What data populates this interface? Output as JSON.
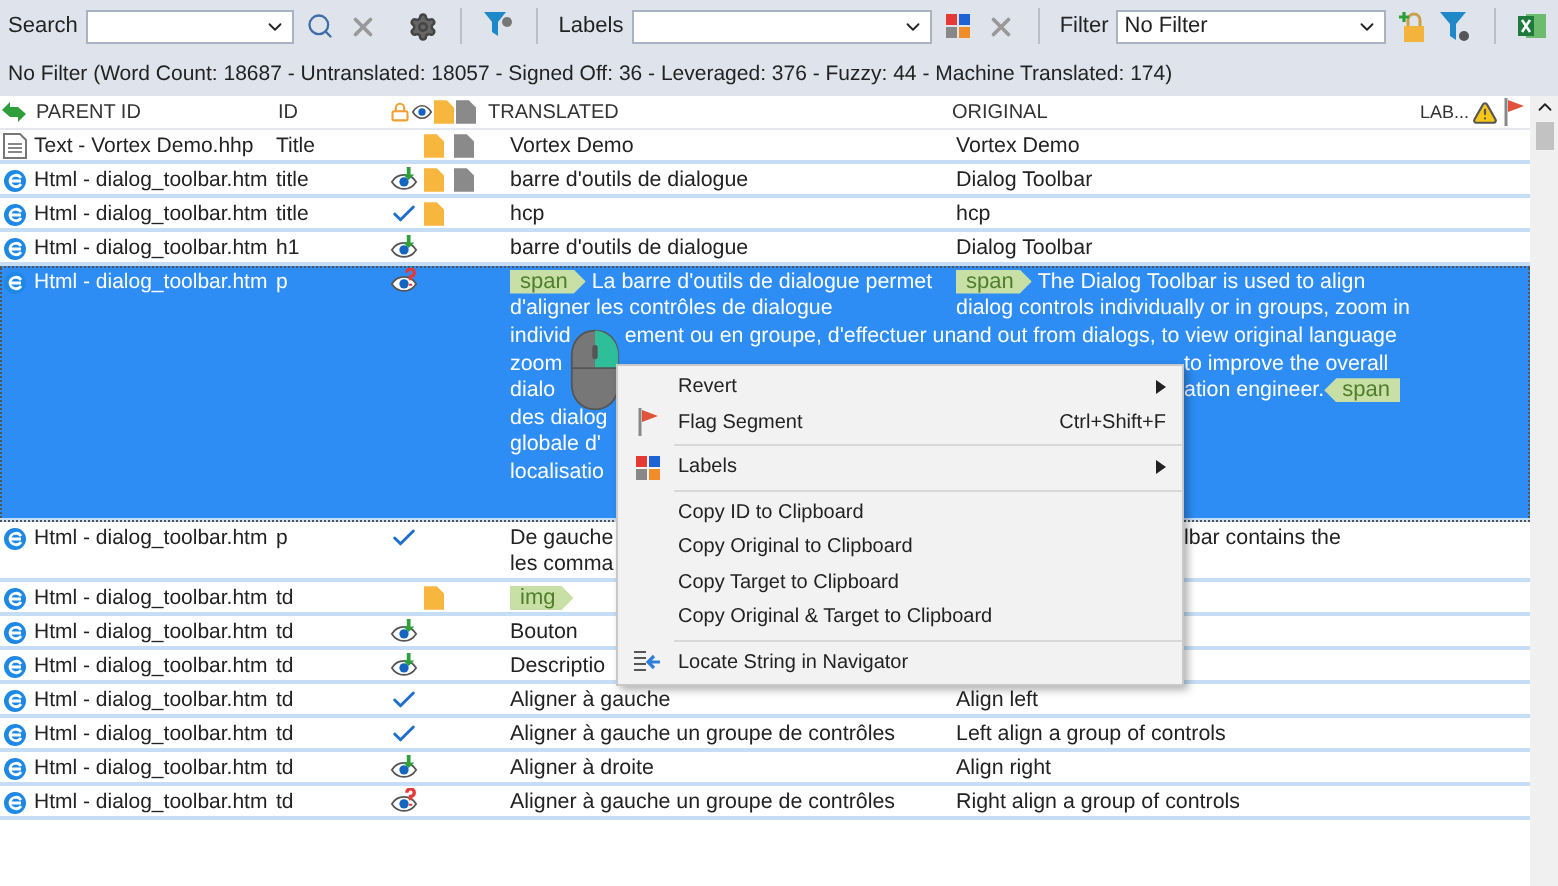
{
  "toolbar": {
    "search_label": "Search",
    "labels_label": "Labels",
    "filter_label": "Filter",
    "filter_value": "No Filter"
  },
  "status_text": "No Filter (Word Count: 18687 - Untranslated: 18057 - Signed Off: 36 - Leveraged: 376 - Fuzzy: 44 - Machine Translated: 174)",
  "columns": {
    "parent_id": "PARENT ID",
    "id": "ID",
    "translated": "TRANSLATED",
    "original": "ORIGINAL",
    "labels": "LAB..."
  },
  "rows": [
    {
      "kind": "text",
      "parent_id": "Text - Vortex Demo.hhp",
      "id": "Title",
      "memo": true,
      "comment": true,
      "selected": false,
      "translated": "Vortex Demo",
      "original": "Vortex Demo"
    },
    {
      "kind": "html",
      "parent_id": "Html - dialog_toolbar.htm",
      "id": "title",
      "status": {
        "kind": "leveraged"
      },
      "memo": true,
      "comment": true,
      "selected": false,
      "translated": "barre d'outils de dialogue",
      "original": "Dialog Toolbar"
    },
    {
      "kind": "html",
      "parent_id": "Html - dialog_toolbar.htm",
      "id": "title",
      "status": {
        "kind": "signed_off"
      },
      "memo": true,
      "comment": false,
      "selected": false,
      "translated": "hcp",
      "original": "hcp"
    },
    {
      "kind": "html",
      "parent_id": "Html - dialog_toolbar.htm",
      "id": "h1",
      "status": {
        "kind": "leveraged"
      },
      "memo": false,
      "comment": false,
      "selected": false,
      "translated": "barre d'outils de dialogue",
      "original": "Dialog Toolbar"
    },
    {
      "kind": "html",
      "parent_id": "Html - dialog_toolbar.htm",
      "id": "p",
      "status": {
        "kind": "unsure"
      },
      "memo": false,
      "comment": false,
      "selected": true,
      "translated": [
        {
          "kind": "full",
          "parts": [
            {
              "kind": "open_tag",
              "text": "span"
            },
            {
              "kind": "text",
              "text": "La barre d'outils de dialogue permet"
            }
          ]
        },
        {
          "kind": "full",
          "parts": [
            {
              "kind": "text",
              "text": "d'aligner les contrôles de dialogue"
            }
          ]
        },
        {
          "kind": "full",
          "parts": [
            {
              "kind": "text",
              "text": "individ"
            },
            {
              "kind": "gap_text",
              "text": "ement ou en groupe, d'effectuer un"
            }
          ]
        },
        {
          "kind": "full",
          "parts": [
            {
              "kind": "text",
              "text": "zoom"
            }
          ]
        },
        {
          "kind": "full",
          "parts": [
            {
              "kind": "text",
              "text": "dialo"
            }
          ]
        },
        {
          "kind": "full",
          "parts": [
            {
              "kind": "text",
              "text": "des dialog"
            }
          ]
        },
        {
          "kind": "full",
          "parts": [
            {
              "kind": "text",
              "text": "globale d'"
            }
          ]
        },
        {
          "kind": "full",
          "parts": [
            {
              "kind": "text",
              "text": "localisatio"
            }
          ]
        }
      ],
      "original": [
        {
          "kind": "full",
          "parts": [
            {
              "kind": "open_tag",
              "text": "span"
            },
            {
              "kind": "text",
              "text": "The Dialog Toolbar is used to align"
            }
          ]
        },
        {
          "kind": "full",
          "parts": [
            {
              "kind": "text",
              "text": "dialog controls individually or in groups, zoom in"
            }
          ]
        },
        {
          "kind": "full",
          "parts": [
            {
              "kind": "text",
              "text": "and out from dialogs, to view original language"
            }
          ]
        },
        {
          "kind": "after_menu",
          "parts": [
            {
              "kind": "text",
              "text": "to improve the overall"
            }
          ]
        },
        {
          "kind": "after_menu",
          "parts": [
            {
              "kind": "text",
              "text": "ation engineer."
            },
            {
              "kind": "close_tag",
              "text": "span"
            }
          ]
        }
      ]
    },
    {
      "kind": "html",
      "parent_id": "Html - dialog_toolbar.htm",
      "id": "p",
      "status": {
        "kind": "signed_off"
      },
      "memo": false,
      "comment": false,
      "selected": false,
      "translated": [
        {
          "kind": "full",
          "parts": [
            {
              "kind": "text",
              "text": "De gauche"
            }
          ]
        },
        {
          "kind": "full",
          "parts": [
            {
              "kind": "text",
              "text": "les comma"
            }
          ]
        }
      ],
      "original": [
        {
          "kind": "after_menu",
          "parts": [
            {
              "kind": "text",
              "text": "lbar contains the"
            }
          ]
        }
      ]
    },
    {
      "kind": "html",
      "parent_id": "Html - dialog_toolbar.htm",
      "id": "td",
      "memo": true,
      "comment": false,
      "selected": false,
      "translated": [
        {
          "kind": "full",
          "parts": [
            {
              "kind": "open_tag",
              "text": "img"
            }
          ]
        }
      ]
    },
    {
      "kind": "html",
      "parent_id": "Html - dialog_toolbar.htm",
      "id": "td",
      "status": {
        "kind": "leveraged"
      },
      "memo": false,
      "comment": false,
      "selected": false,
      "translated": "Bouton"
    },
    {
      "kind": "html",
      "parent_id": "Html - dialog_toolbar.htm",
      "id": "td",
      "status": {
        "kind": "leveraged"
      },
      "memo": false,
      "comment": false,
      "selected": false,
      "translated": "Descriptio"
    },
    {
      "kind": "html",
      "parent_id": "Html - dialog_toolbar.htm",
      "id": "td",
      "status": {
        "kind": "signed_off"
      },
      "memo": false,
      "comment": false,
      "selected": false,
      "translated": "Aligner à gauche",
      "original": "Align left"
    },
    {
      "kind": "html",
      "parent_id": "Html - dialog_toolbar.htm",
      "id": "td",
      "status": {
        "kind": "signed_off"
      },
      "memo": false,
      "comment": false,
      "selected": false,
      "translated": "Aligner à gauche un groupe de contrôles",
      "original": "Left align a group of controls"
    },
    {
      "kind": "html",
      "parent_id": "Html - dialog_toolbar.htm",
      "id": "td",
      "status": {
        "kind": "leveraged"
      },
      "memo": false,
      "comment": false,
      "selected": false,
      "translated": "Aligner à droite",
      "original": "Align right"
    },
    {
      "kind": "html",
      "parent_id": "Html - dialog_toolbar.htm",
      "id": "td",
      "status": {
        "kind": "unsure"
      },
      "memo": false,
      "comment": false,
      "selected": false,
      "translated": "Aligner à gauche un groupe de contrôles",
      "original": "Right align a group of controls"
    }
  ],
  "context_menu": [
    [
      {
        "kind": "submenu",
        "label": "Revert"
      },
      {
        "kind": "flag",
        "label": "Flag Segment",
        "shortcut": "Ctrl+Shift+F"
      }
    ],
    [
      {
        "kind": "labels",
        "label": "Labels"
      }
    ],
    [
      {
        "kind": "plain",
        "label": "Copy ID to Clipboard"
      },
      {
        "kind": "plain",
        "label": "Copy Original to Clipboard"
      },
      {
        "kind": "plain",
        "label": "Copy Target to Clipboard"
      },
      {
        "kind": "plain",
        "label": "Copy Original & Target to Clipboard"
      }
    ],
    [
      {
        "kind": "locate",
        "label": "Locate String in Navigator"
      }
    ]
  ]
}
